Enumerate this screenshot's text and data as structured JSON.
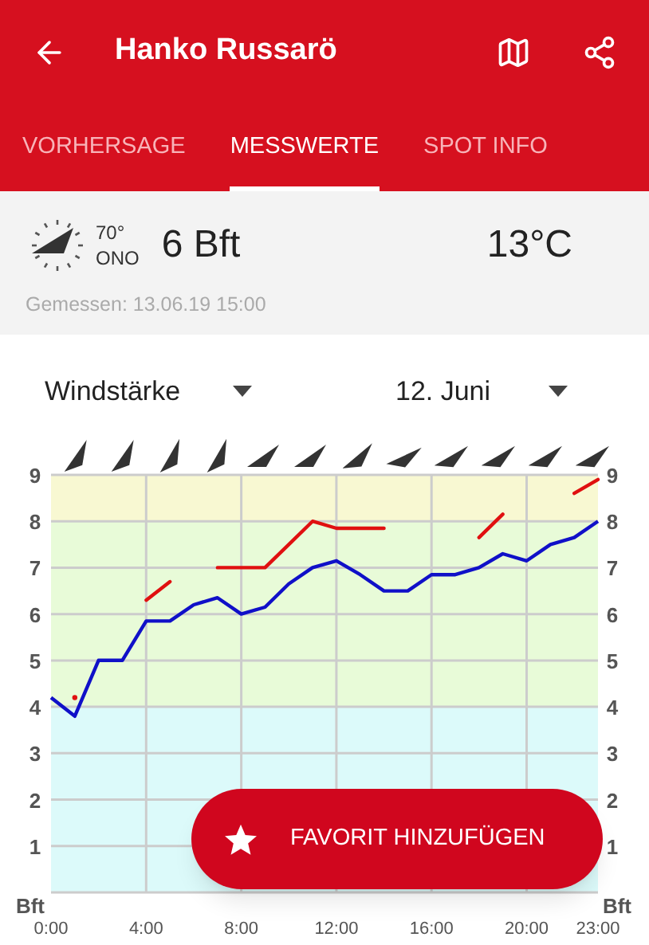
{
  "header": {
    "title": "Hanko Russarö"
  },
  "tabs": [
    {
      "label": "VORHERSAGE",
      "selected": false
    },
    {
      "label": "MESSWERTE",
      "selected": true
    },
    {
      "label": "SPOT INFO",
      "selected": false
    }
  ],
  "current": {
    "direction_degrees": "70°",
    "direction_name": "ONO",
    "wind": "6 Bft",
    "temperature": "13°C",
    "measured": "Gemessen: 13.06.19 15:00"
  },
  "selectors": [
    {
      "value": "Windstärke"
    },
    {
      "value": "12. Juni"
    }
  ],
  "chart_data": {
    "type": "line",
    "ylabel": "Bft",
    "xticks": [
      {
        "value": 0,
        "label": "0:00"
      },
      {
        "value": 4,
        "label": "4:00"
      },
      {
        "value": 8,
        "label": "8:00"
      },
      {
        "value": 12,
        "label": "12:00"
      },
      {
        "value": 16,
        "label": "16:00"
      },
      {
        "value": 20,
        "label": "20:00"
      },
      {
        "value": 23,
        "label": "23:00"
      }
    ],
    "yticks": [
      1,
      2,
      3,
      4,
      5,
      6,
      7,
      8,
      9
    ],
    "xlim": [
      0,
      23
    ],
    "ylim": [
      0,
      9
    ],
    "grid": true,
    "bands": [
      {
        "axis": "y",
        "from": 8,
        "to": 9,
        "color": "#f8f8d2"
      },
      {
        "axis": "y",
        "from": 4,
        "to": 8,
        "color": "#e8fbd8"
      },
      {
        "axis": "y",
        "from": 0,
        "to": 4,
        "color": "#dcfafa"
      }
    ],
    "x": [
      0,
      1,
      2,
      3,
      4,
      5,
      6,
      7,
      8,
      9,
      10,
      11,
      12,
      13,
      14,
      15,
      16,
      17,
      18,
      19,
      20,
      21,
      22,
      23
    ],
    "series": [
      {
        "color": "#1010c8",
        "values": [
          4.2,
          3.8,
          5,
          5,
          5.85,
          5.85,
          6.2,
          6.35,
          6,
          6.15,
          6.65,
          7,
          7.15,
          6.85,
          6.5,
          6.5,
          6.85,
          6.85,
          7,
          7.3,
          7.15,
          7.5,
          7.65,
          8
        ]
      },
      {
        "color": "#e01010",
        "values": [
          null,
          4.2,
          null,
          null,
          6.3,
          6.7,
          null,
          7,
          7,
          7,
          7.5,
          8,
          7.85,
          7.85,
          7.85,
          null,
          null,
          null,
          7.65,
          8.15,
          null,
          null,
          8.6,
          8.9
        ]
      }
    ]
  },
  "left_axis": {
    "labels": [
      "9",
      "8",
      "7",
      "6",
      "5",
      "4",
      "3",
      "2",
      "1"
    ],
    "unit": "Bft"
  },
  "fab": {
    "label": "FAVORIT HINZUFÜGEN"
  }
}
